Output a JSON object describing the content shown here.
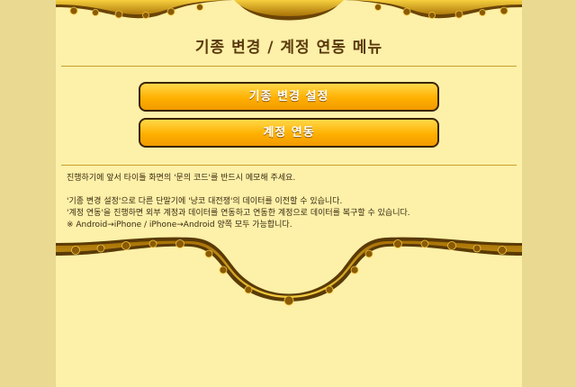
{
  "title": "기종 변경 / 계정 연동 메뉴",
  "buttons": {
    "device_change": "기종 변경 설정",
    "account_link": "계정 연동"
  },
  "notes": {
    "line1": "진행하기에 앞서 타이틀 화면의 '문의 코드'를 반드시 메모해 주세요.",
    "line2": "'기종 변경 설정'으로 다른 단말기에 '냥코 대전쟁'의 데이터를 이전할 수 있습니다.",
    "line3": "'계정 연동'을 진행하면 외부 계정과 데이터를 연동하고 연동한 계정으로 데이터를 복구할 수 있습니다.",
    "line4": "※ Android→iPhone / iPhone→Android 양쪽 모두 가능합니다."
  },
  "colors": {
    "background": "#e9d991",
    "panel": "#fdf0a8",
    "button_top": "#ffd84a",
    "button_bottom": "#f29a00",
    "title_text": "#5a3a0c",
    "ornament_gold": "#c8960a",
    "ornament_dark": "#5a3a06"
  }
}
